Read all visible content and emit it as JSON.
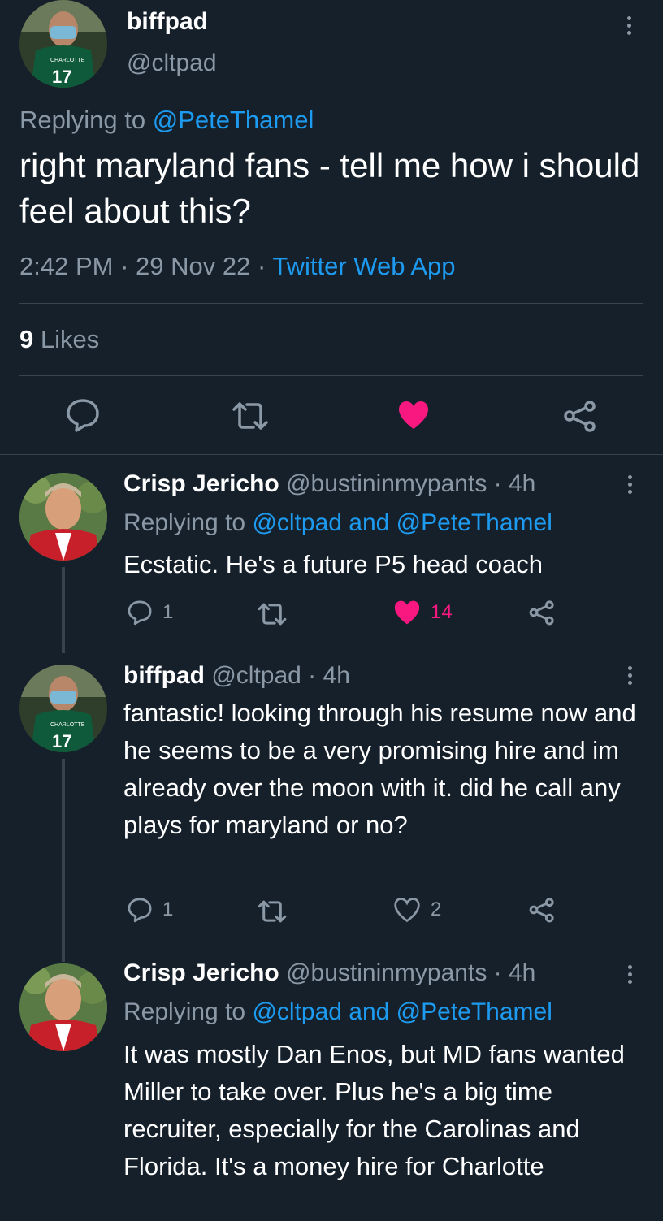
{
  "main_tweet": {
    "display_name": "biffpad",
    "handle": "@cltpad",
    "replying_prefix": "Replying to ",
    "replying_to": "@PeteThamel",
    "text": "right maryland fans - tell me how i should feel about this?",
    "time": "2:42 PM",
    "date": "29 Nov 22",
    "client": "Twitter Web App",
    "likes_count": "9",
    "likes_label": "Likes"
  },
  "replies": [
    {
      "display_name": "Crisp Jericho",
      "handle": "@bustininmypants",
      "time": "4h",
      "replying_prefix": "Replying to ",
      "replying_to": "@cltpad and @PeteThamel",
      "text": "Ecstatic. He's a future P5 head coach",
      "reply_count": "1",
      "like_count": "14",
      "liked": true
    },
    {
      "display_name": "biffpad",
      "handle": "@cltpad",
      "time": "4h",
      "text": "fantastic! looking through his resume now and he seems to be a very promising hire and im already over the moon with it. did he call any plays for maryland or no?",
      "reply_count": "1",
      "like_count": "2",
      "liked": false
    },
    {
      "display_name": "Crisp Jericho",
      "handle": "@bustininmypants",
      "time": "4h",
      "replying_prefix": "Replying to ",
      "replying_to": "@cltpad and @PeteThamel",
      "text": "It was mostly Dan Enos, but MD fans wanted Miller to take over. Plus he's a big time recruiter, especially for the Carolinas and Florida. It's a money hire for Charlotte"
    }
  ],
  "colors": {
    "background": "#15202b",
    "accent": "#1d9bf0",
    "like": "#f91880",
    "muted": "#8b98a5",
    "divider": "#38444d"
  }
}
